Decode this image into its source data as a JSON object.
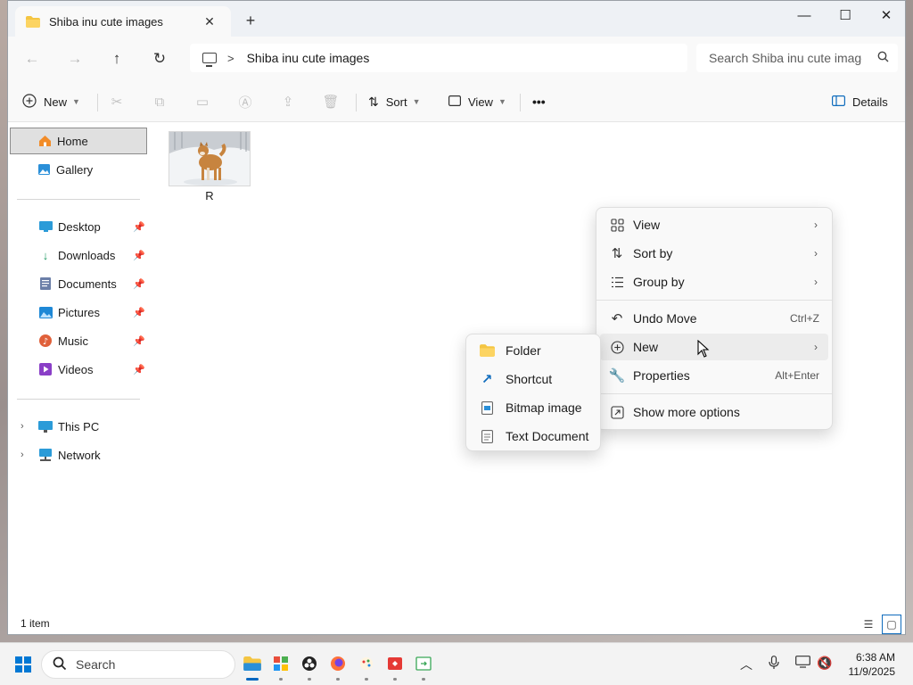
{
  "window": {
    "tab_title": "Shiba inu cute images",
    "tab_close": "✕",
    "new_tab": "+",
    "minimize": "—",
    "maximize": "☐",
    "close": "✕"
  },
  "navigation": {
    "back": "←",
    "forward": "→",
    "up": "↑",
    "refresh": "↻",
    "breadcrumb": "Shiba inu cute images",
    "separator": ">",
    "search_placeholder": "Search Shiba inu cute images"
  },
  "toolbar": {
    "new_label": "New",
    "sort_label": "Sort",
    "view_label": "View",
    "more_label": "•••",
    "details_label": "Details"
  },
  "sidebar": {
    "home": "Home",
    "gallery": "Gallery",
    "quick_access": [
      {
        "label": "Desktop",
        "icon": "desktop-icon"
      },
      {
        "label": "Downloads",
        "icon": "downloads-icon"
      },
      {
        "label": "Documents",
        "icon": "documents-icon"
      },
      {
        "label": "Pictures",
        "icon": "pictures-icon"
      },
      {
        "label": "Music",
        "icon": "music-icon"
      },
      {
        "label": "Videos",
        "icon": "videos-icon"
      }
    ],
    "this_pc": "This PC",
    "network": "Network"
  },
  "content": {
    "file_name": "R"
  },
  "status": {
    "item_count": "1 item"
  },
  "context_menu": {
    "items": [
      {
        "label": "View",
        "icon": "view-grid-icon",
        "has_submenu": true
      },
      {
        "label": "Sort by",
        "icon": "sort-icon",
        "has_submenu": true
      },
      {
        "label": "Group by",
        "icon": "group-icon",
        "has_submenu": true
      },
      {
        "label": "Undo Move",
        "icon": "undo-icon",
        "shortcut": "Ctrl+Z"
      },
      {
        "label": "New",
        "icon": "new-plus-icon",
        "has_submenu": true
      },
      {
        "label": "Properties",
        "icon": "wrench-icon",
        "shortcut": "Alt+Enter"
      },
      {
        "label": "Show more options",
        "icon": "more-options-icon"
      }
    ]
  },
  "new_submenu": {
    "items": [
      {
        "label": "Folder",
        "icon": "folder-icon"
      },
      {
        "label": "Shortcut",
        "icon": "shortcut-icon"
      },
      {
        "label": "Bitmap image",
        "icon": "bitmap-icon"
      },
      {
        "label": "Text Document",
        "icon": "text-document-icon"
      }
    ]
  },
  "taskbar": {
    "search_label": "Search",
    "time": "6:38 AM",
    "date": "11/9/2025"
  },
  "colors": {
    "accent": "#0078d4",
    "folder": "#f4c542"
  }
}
